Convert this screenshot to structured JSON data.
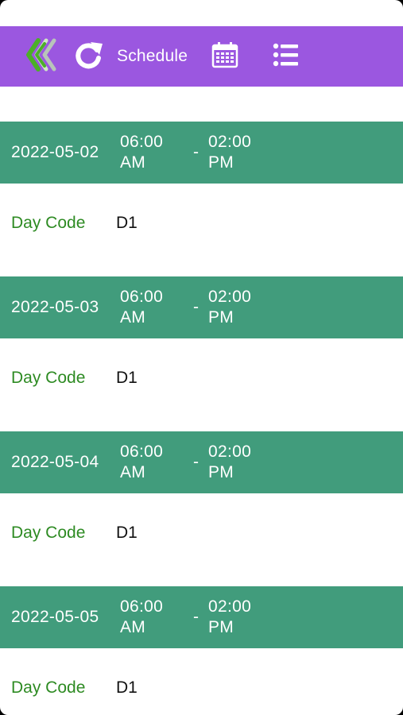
{
  "toolbar": {
    "title": "Schedule",
    "icons": {
      "back": "double-chevron-left-icon",
      "refresh": "refresh-icon",
      "calendar": "calendar-icon",
      "list": "list-icon"
    }
  },
  "colors": {
    "toolbar_bg": "#9b57e0",
    "header_bg": "#419c7c",
    "label_green": "#2e8b23",
    "back_icon_green": "#4caf28"
  },
  "schedule": [
    {
      "date": "2022-05-02",
      "start_time": "06:00",
      "start_ampm": "AM",
      "separator": "-",
      "end_time": "02:00",
      "end_ampm": "PM",
      "day_code_label": "Day Code",
      "day_code": "D1"
    },
    {
      "date": "2022-05-03",
      "start_time": "06:00",
      "start_ampm": "AM",
      "separator": "-",
      "end_time": "02:00",
      "end_ampm": "PM",
      "day_code_label": "Day Code",
      "day_code": "D1"
    },
    {
      "date": "2022-05-04",
      "start_time": "06:00",
      "start_ampm": "AM",
      "separator": "-",
      "end_time": "02:00",
      "end_ampm": "PM",
      "day_code_label": "Day Code",
      "day_code": "D1"
    },
    {
      "date": "2022-05-05",
      "start_time": "06:00",
      "start_ampm": "AM",
      "separator": "-",
      "end_time": "02:00",
      "end_ampm": "PM",
      "day_code_label": "Day Code",
      "day_code": "D1"
    }
  ]
}
